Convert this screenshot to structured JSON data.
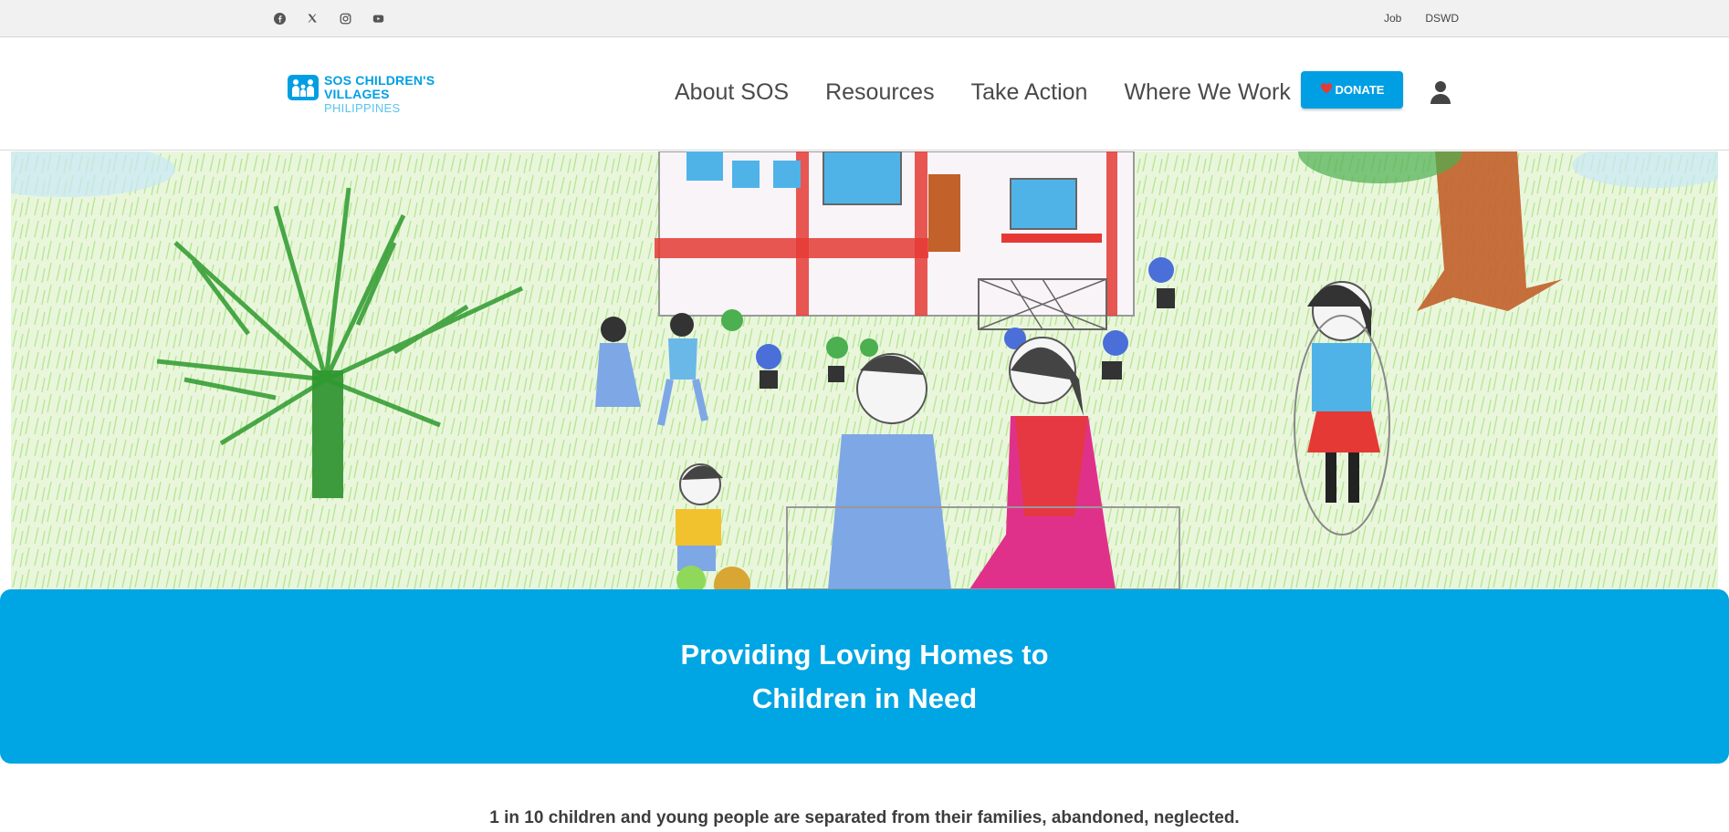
{
  "colors": {
    "brand_blue": "#009fe3",
    "banner_blue": "#00a5e3",
    "topbar_bg": "#f1f1f1",
    "heart_red": "#e53935"
  },
  "social": [
    {
      "icon": "facebook-icon"
    },
    {
      "icon": "x-twitter-icon"
    },
    {
      "icon": "instagram-icon"
    },
    {
      "icon": "youtube-icon"
    }
  ],
  "top_links": {
    "job": "Job",
    "dswd": "DSWD"
  },
  "logo": {
    "line1": "SOS CHILDREN'S",
    "line2": "VILLAGES",
    "line3": "PHILIPPINES",
    "icon": "sos-children-figures-icon"
  },
  "nav": {
    "about": "About SOS",
    "resources": "Resources",
    "take_action": "Take Action",
    "where_we_work": "Where We Work"
  },
  "donate": {
    "label": "DONATE",
    "icon": "heart-icon"
  },
  "account": {
    "icon": "user-icon"
  },
  "hero": {
    "image": "child-crayon-drawing-of-village-house-and-children"
  },
  "banner": {
    "line1": "Providing Loving Homes to",
    "line2": "Children in Need"
  },
  "intro": {
    "text": "1 in 10 children and young people are separated from their families, abandoned, neglected."
  }
}
